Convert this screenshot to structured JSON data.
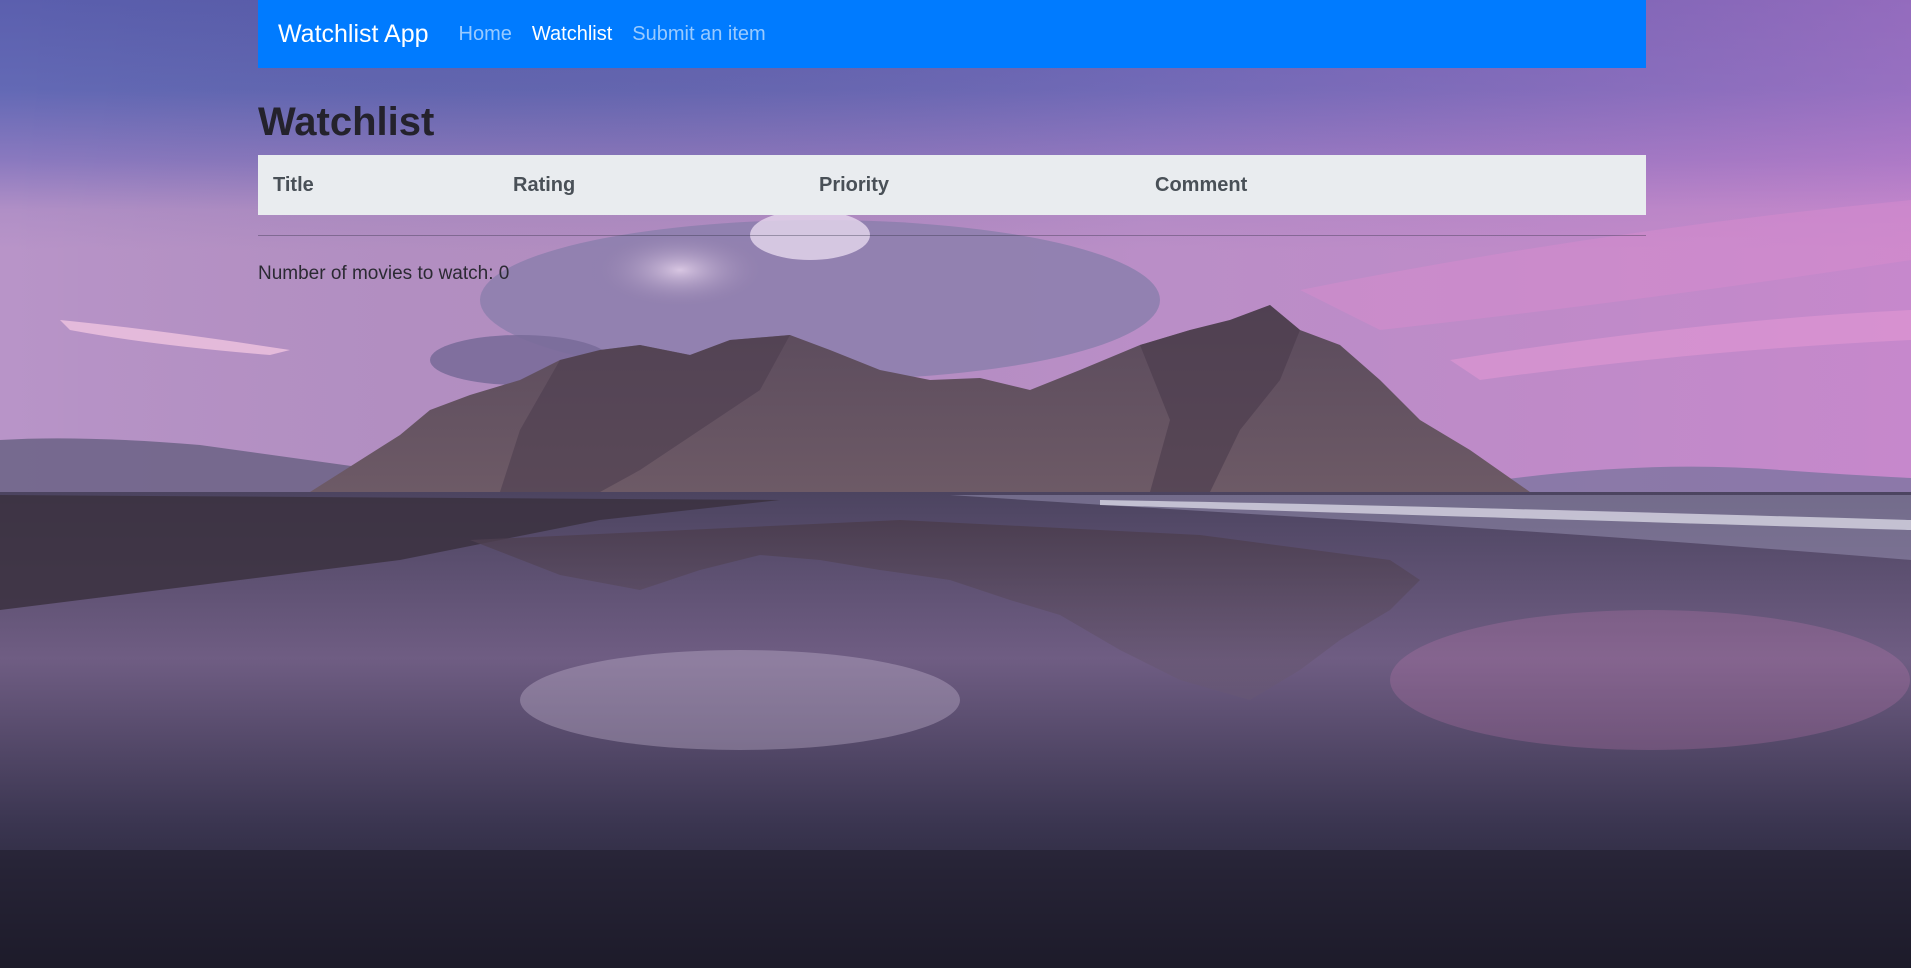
{
  "navbar": {
    "brand": "Watchlist App",
    "links": [
      {
        "label": "Home",
        "active": false
      },
      {
        "label": "Watchlist",
        "active": true
      },
      {
        "label": "Submit an item",
        "active": false
      }
    ],
    "color": "#007bff"
  },
  "page": {
    "title": "Watchlist"
  },
  "table": {
    "columns": [
      "Title",
      "Rating",
      "Priority",
      "Comment"
    ],
    "rows": []
  },
  "summary": {
    "text": "Number of movies to watch: 0"
  },
  "background": {
    "description_icon": "landscape-background"
  }
}
